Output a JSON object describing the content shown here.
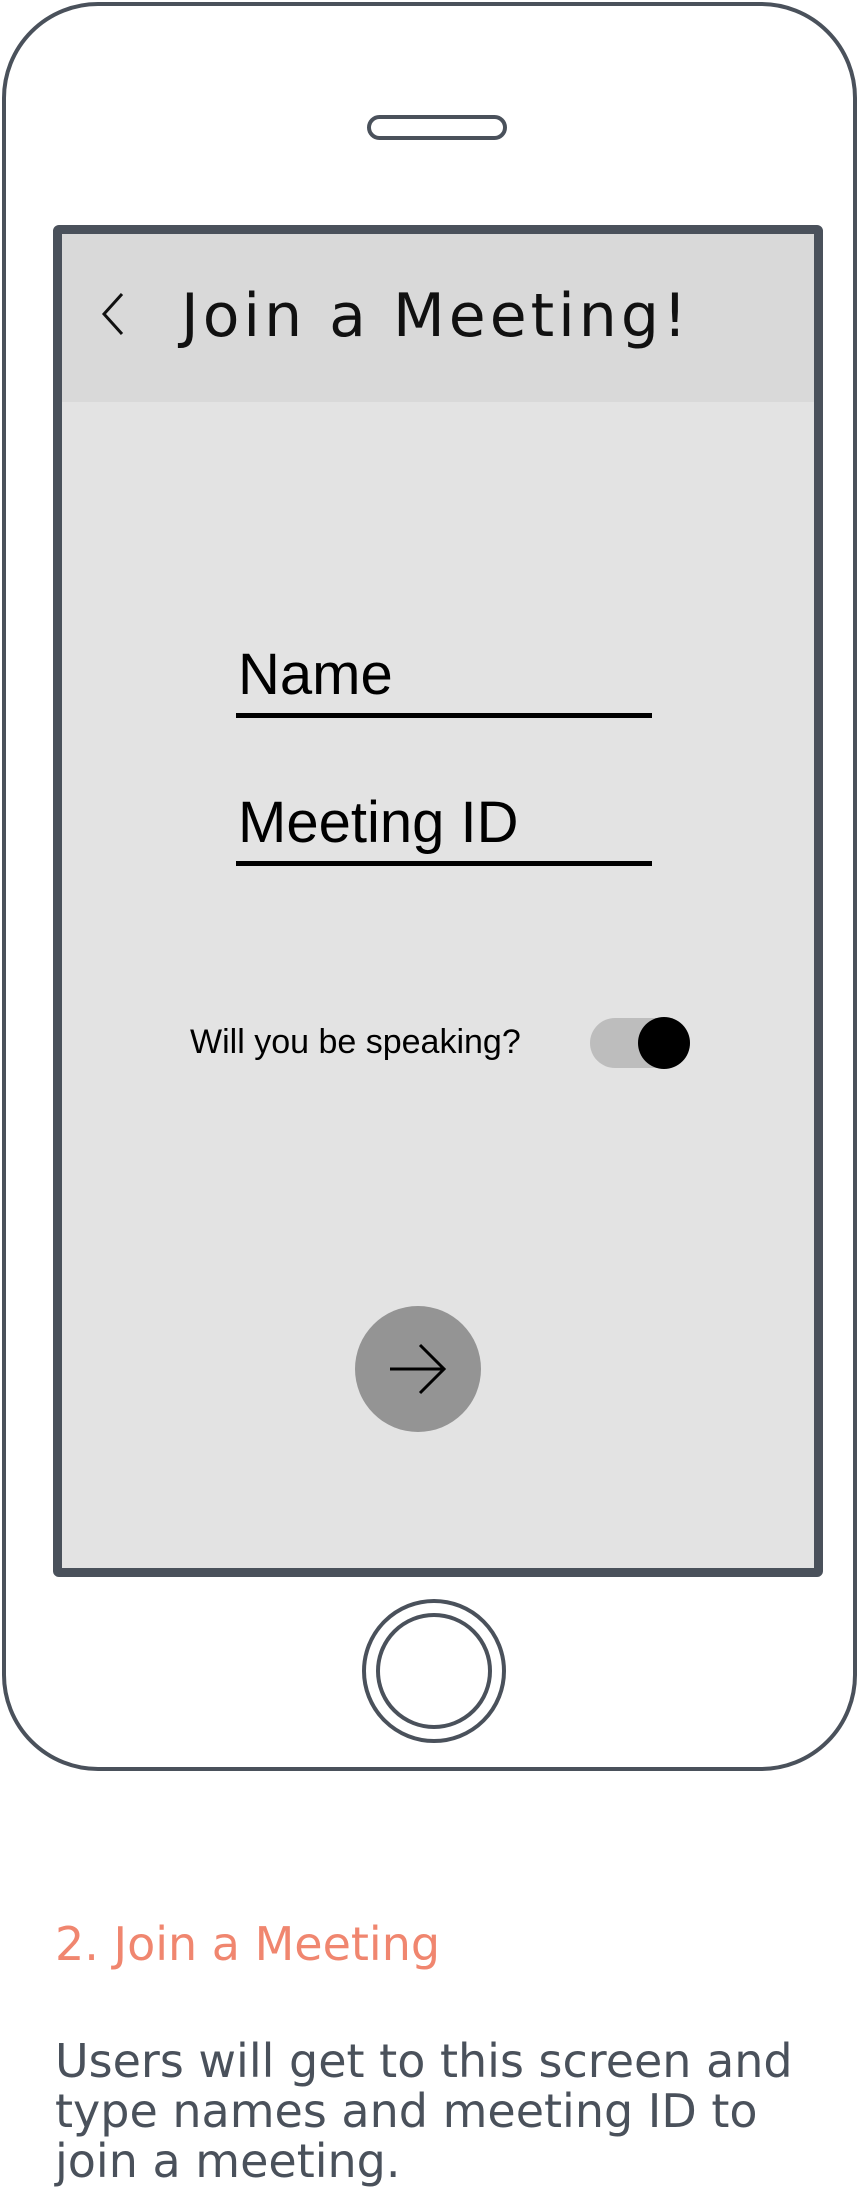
{
  "app_bar": {
    "back_icon": "chevron-left-icon",
    "title": "Join a Meeting!"
  },
  "form": {
    "name_placeholder": "Name",
    "meeting_id_placeholder": "Meeting ID",
    "speaking_label": "Will you be speaking?",
    "speaking_toggle_on": true
  },
  "next_button": {
    "icon": "arrow-right-icon"
  },
  "caption": {
    "title": "2. Join a Meeting",
    "body": "Users will get to this screen and type names and meeting ID to join a meeting."
  },
  "colors": {
    "frame": "#4a515b",
    "screen_bg": "#e3e3e3",
    "app_bar_bg": "#d9d9d9",
    "caption_title": "#f0866f",
    "button_bg": "#949494",
    "toggle_track": "#bdbdbd",
    "toggle_thumb": "#000000"
  }
}
